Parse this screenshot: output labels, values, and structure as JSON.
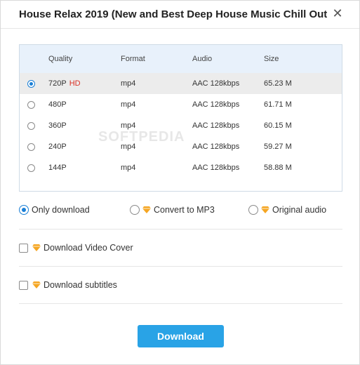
{
  "dialog": {
    "title": "House Relax 2019 (New and Best Deep House Music  Chill Out",
    "close_icon": "close-icon"
  },
  "table": {
    "headers": {
      "quality": "Quality",
      "format": "Format",
      "audio": "Audio",
      "size": "Size"
    },
    "rows": [
      {
        "quality": "720P",
        "badge": "HD",
        "format": "mp4",
        "audio": "AAC 128kbps",
        "size": "65.23 M",
        "selected": true
      },
      {
        "quality": "480P",
        "badge": "",
        "format": "mp4",
        "audio": "AAC 128kbps",
        "size": "61.71 M",
        "selected": false
      },
      {
        "quality": "360P",
        "badge": "",
        "format": "mp4",
        "audio": "AAC 128kbps",
        "size": "60.15 M",
        "selected": false
      },
      {
        "quality": "240P",
        "badge": "",
        "format": "mp4",
        "audio": "AAC 128kbps",
        "size": "59.27 M",
        "selected": false
      },
      {
        "quality": "144P",
        "badge": "",
        "format": "mp4",
        "audio": "AAC 128kbps",
        "size": "58.88 M",
        "selected": false
      }
    ]
  },
  "watermark": "SOFTPEDIA",
  "download_mode": {
    "only_download": "Only download",
    "convert_mp3": "Convert to MP3",
    "original_audio": "Original audio",
    "selected": "only_download"
  },
  "extras": {
    "video_cover": "Download Video Cover",
    "subtitles": "Download subtitles",
    "video_cover_checked": false,
    "subtitles_checked": false
  },
  "actions": {
    "download_label": "Download"
  },
  "colors": {
    "accent": "#29a3e6",
    "hd_badge": "#d93025",
    "premium_gem": "#f5a623",
    "header_bg": "#e8f1fb",
    "selected_row": "#ececec"
  }
}
